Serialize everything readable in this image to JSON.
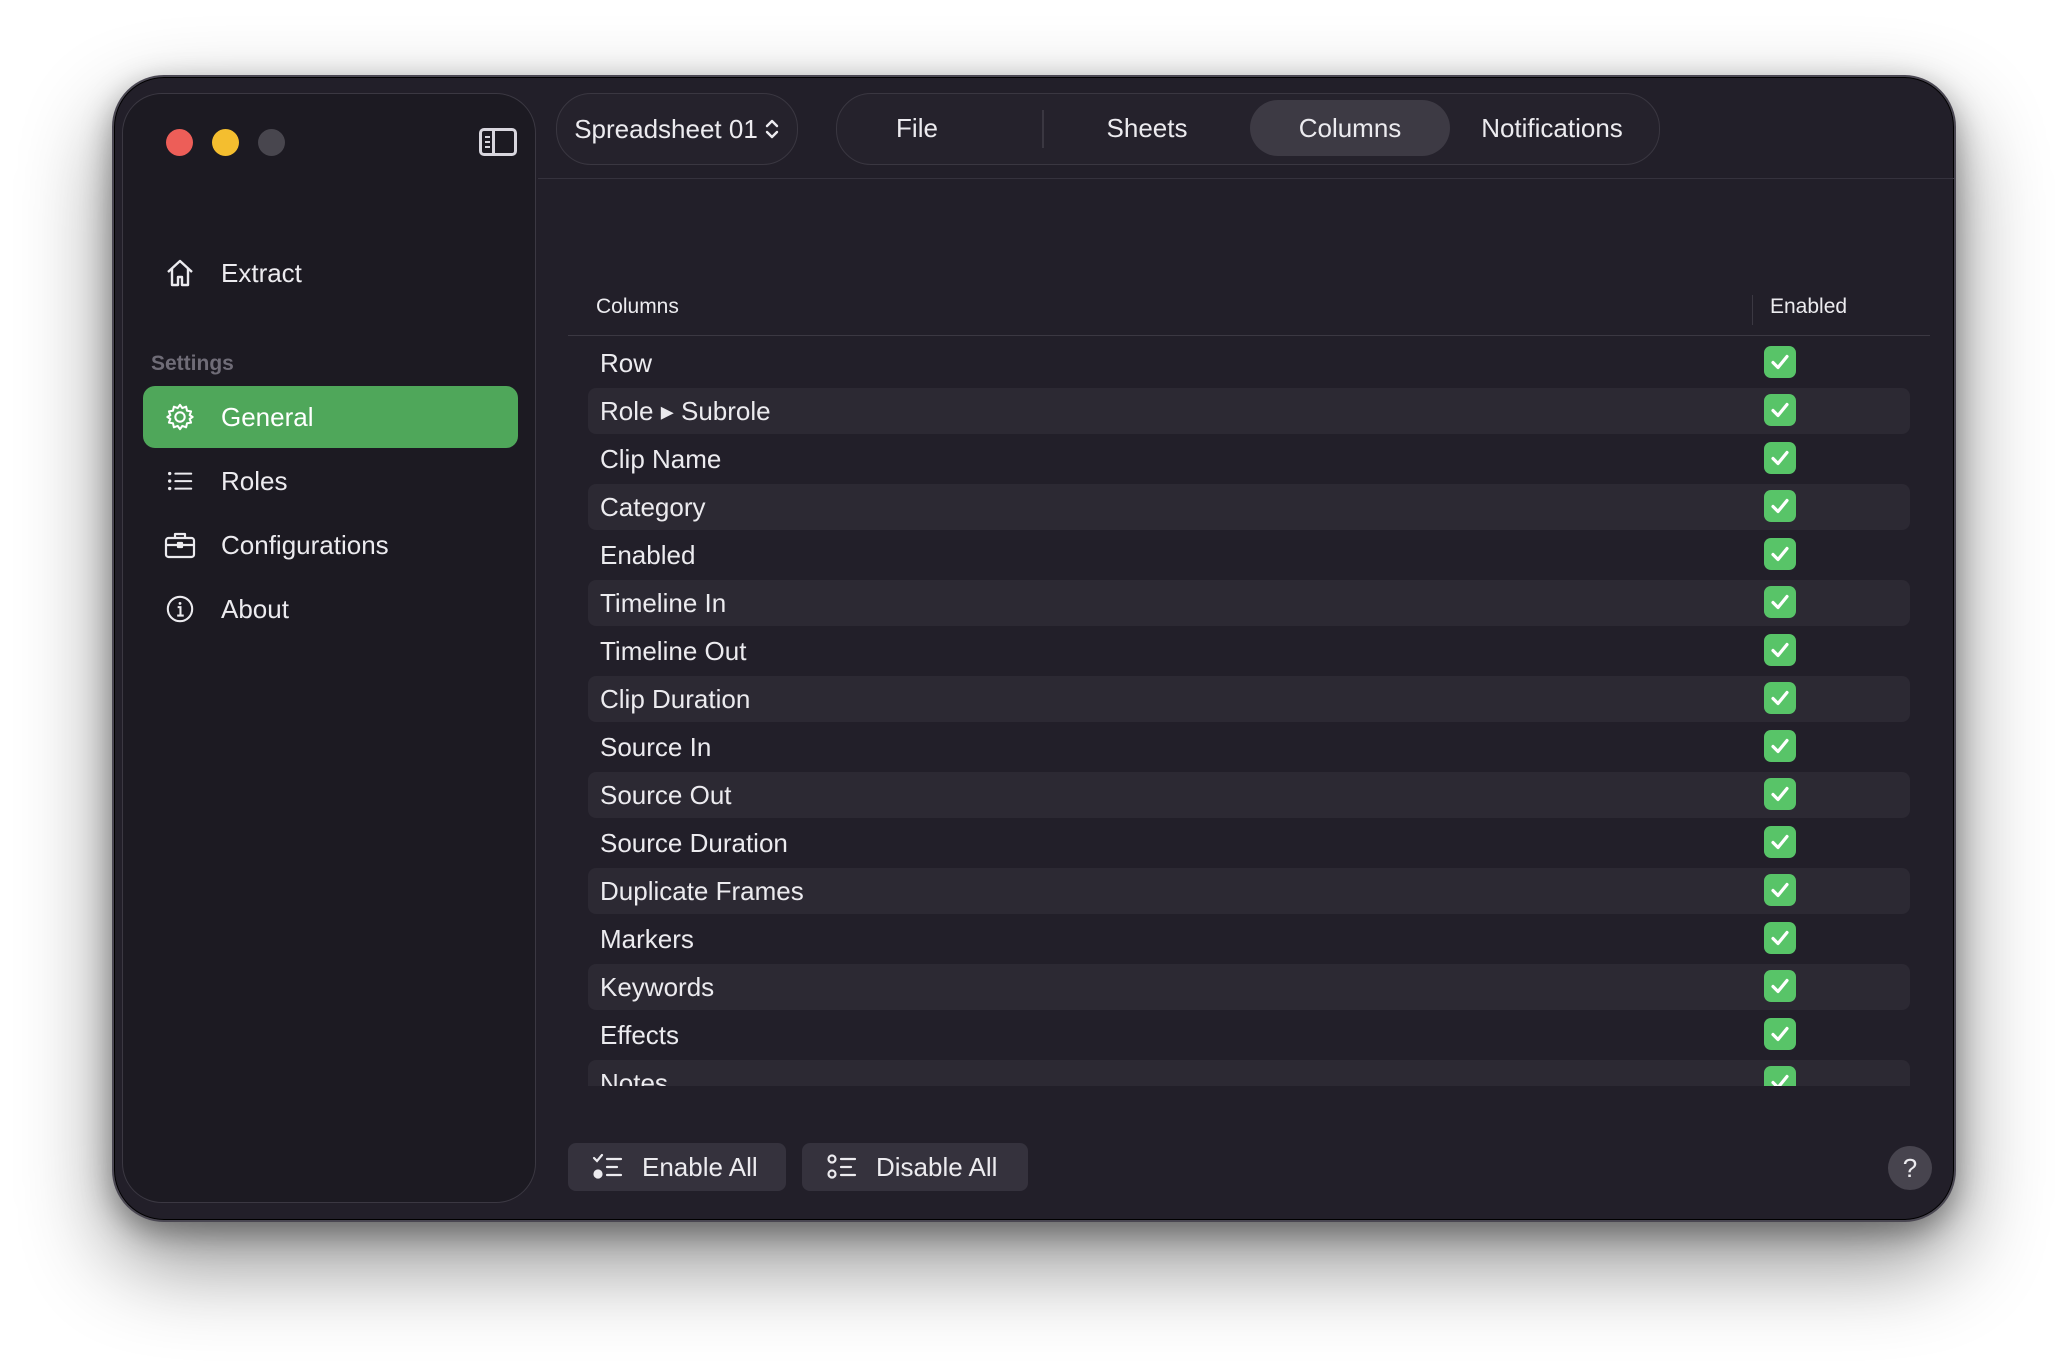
{
  "window": {
    "traffic_lights": [
      "close",
      "minimize",
      "zoom"
    ]
  },
  "sidebar": {
    "top_item": {
      "label": "Extract",
      "icon": "house-icon"
    },
    "section_label": "Settings",
    "items": [
      {
        "label": "General",
        "icon": "gear-icon",
        "active": true
      },
      {
        "label": "Roles",
        "icon": "list-icon",
        "active": false
      },
      {
        "label": "Configurations",
        "icon": "briefcase-icon",
        "active": false
      },
      {
        "label": "About",
        "icon": "info-icon",
        "active": false
      }
    ]
  },
  "toolbar": {
    "document": "Spreadsheet 01",
    "tabs": [
      {
        "label": "File",
        "active": false
      },
      {
        "label": "Sheets",
        "active": false
      },
      {
        "label": "Columns",
        "active": true
      },
      {
        "label": "Notifications",
        "active": false
      }
    ]
  },
  "table": {
    "headers": [
      "Columns",
      "Enabled"
    ],
    "rows": [
      {
        "name": "Row",
        "enabled": true
      },
      {
        "name": "Role ▸ Subrole",
        "enabled": true
      },
      {
        "name": "Clip Name",
        "enabled": true
      },
      {
        "name": "Category",
        "enabled": true
      },
      {
        "name": "Enabled",
        "enabled": true
      },
      {
        "name": "Timeline In",
        "enabled": true
      },
      {
        "name": "Timeline Out",
        "enabled": true
      },
      {
        "name": "Clip Duration",
        "enabled": true
      },
      {
        "name": "Source In",
        "enabled": true
      },
      {
        "name": "Source Out",
        "enabled": true
      },
      {
        "name": "Source Duration",
        "enabled": true
      },
      {
        "name": "Duplicate Frames",
        "enabled": true
      },
      {
        "name": "Markers",
        "enabled": true
      },
      {
        "name": "Keywords",
        "enabled": true
      },
      {
        "name": "Effects",
        "enabled": true
      },
      {
        "name": "Notes",
        "enabled": true
      }
    ]
  },
  "footer": {
    "enable_all": "Enable All",
    "disable_all": "Disable All",
    "help": "?"
  },
  "colors": {
    "accent_green": "#4fa75a",
    "check_green": "#58c468",
    "window_bg": "#221f29",
    "sidebar_bg": "#1c1a22"
  }
}
